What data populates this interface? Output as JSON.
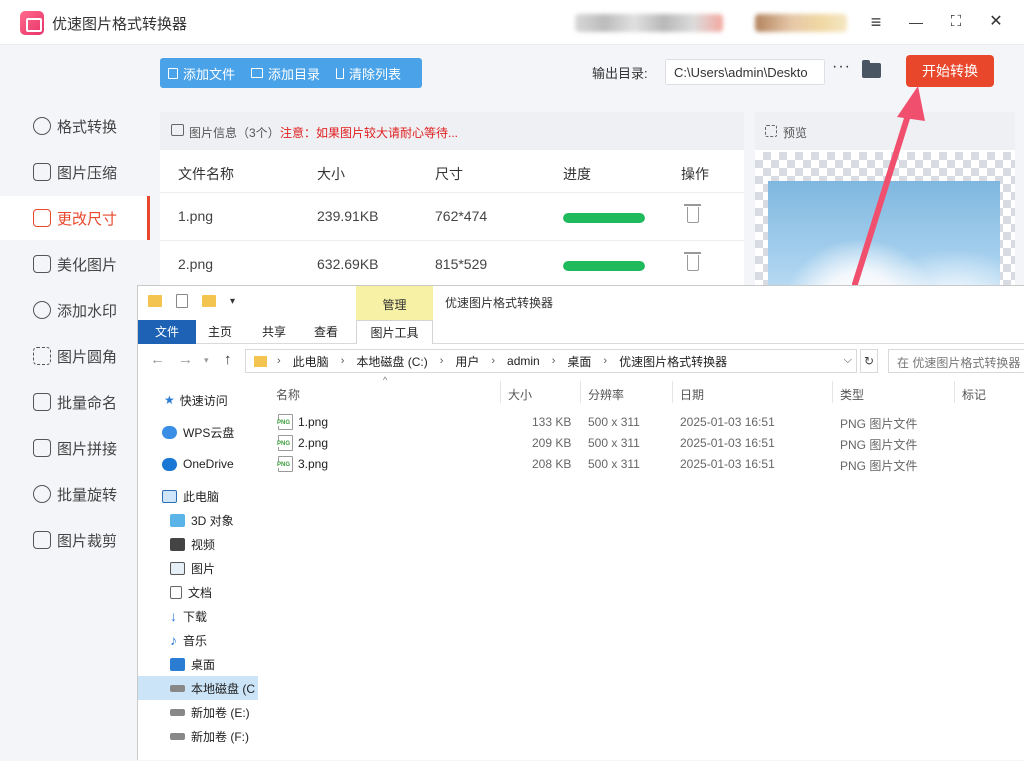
{
  "app": {
    "title": "优速图片格式转换器"
  },
  "window_controls": {
    "menu": "≡",
    "minimize": "—",
    "maximize": "⛶",
    "close": "✕"
  },
  "sidebar": {
    "items": [
      {
        "label": "格式转换",
        "icon": "format-convert-icon",
        "active": false
      },
      {
        "label": "图片压缩",
        "icon": "compress-icon",
        "active": false
      },
      {
        "label": "更改尺寸",
        "icon": "resize-icon",
        "active": true
      },
      {
        "label": "美化图片",
        "icon": "beautify-icon",
        "active": false
      },
      {
        "label": "添加水印",
        "icon": "watermark-icon",
        "active": false
      },
      {
        "label": "图片圆角",
        "icon": "round-corner-icon",
        "active": false
      },
      {
        "label": "批量命名",
        "icon": "rename-icon",
        "active": false
      },
      {
        "label": "图片拼接",
        "icon": "stitch-icon",
        "active": false
      },
      {
        "label": "批量旋转",
        "icon": "rotate-icon",
        "active": false
      },
      {
        "label": "图片裁剪",
        "icon": "crop-icon",
        "active": false
      }
    ]
  },
  "toolbar": {
    "add_file": "添加文件",
    "add_dir": "添加目录",
    "clear_list": "清除列表",
    "output_label": "输出目录:",
    "output_path": "C:\\Users\\admin\\Deskto",
    "more": "···",
    "start": "开始转换"
  },
  "list": {
    "info": "图片信息（3个）",
    "note": "注意：如果图片较大请耐心等待...",
    "headers": {
      "name": "文件名称",
      "size": "大小",
      "dims": "尺寸",
      "progress": "进度",
      "action": "操作"
    },
    "rows": [
      {
        "name": "1.png",
        "size": "239.91KB",
        "dims": "762*474",
        "progress": 1.0
      },
      {
        "name": "2.png",
        "size": "632.69KB",
        "dims": "815*529",
        "progress": 1.0
      }
    ]
  },
  "preview": {
    "label": "预览"
  },
  "explorer": {
    "manage_tab": "管理",
    "title": "优速图片格式转换器",
    "ribbon": [
      "文件",
      "主页",
      "共享",
      "查看",
      "图片工具"
    ],
    "breadcrumb": [
      "此电脑",
      "本地磁盘 (C:)",
      "用户",
      "admin",
      "桌面",
      "优速图片格式转换器"
    ],
    "search_placeholder": "在 优速图片格式转换器",
    "nav": [
      {
        "label": "快速访问",
        "icon": "star-icon"
      },
      {
        "label": "WPS云盘",
        "icon": "cloud-icon"
      },
      {
        "label": "OneDrive",
        "icon": "onedrive-icon"
      },
      {
        "label": "此电脑",
        "icon": "pc-icon"
      },
      {
        "label": "3D 对象",
        "icon": "cube-icon"
      },
      {
        "label": "视频",
        "icon": "video-icon"
      },
      {
        "label": "图片",
        "icon": "picture-icon"
      },
      {
        "label": "文档",
        "icon": "document-icon"
      },
      {
        "label": "下载",
        "icon": "download-icon"
      },
      {
        "label": "音乐",
        "icon": "music-icon"
      },
      {
        "label": "桌面",
        "icon": "desktop-icon"
      },
      {
        "label": "本地磁盘 (C",
        "icon": "drive-icon"
      },
      {
        "label": "新加卷 (E:)",
        "icon": "drive-icon"
      },
      {
        "label": "新加卷 (F:)",
        "icon": "drive-icon"
      }
    ],
    "columns": {
      "name": "名称",
      "size": "大小",
      "resolution": "分辨率",
      "date": "日期",
      "type": "类型",
      "tags": "标记"
    },
    "files": [
      {
        "name": "1.png",
        "size": "133 KB",
        "resolution": "500 x 311",
        "date": "2025-01-03 16:51",
        "type": "PNG 图片文件"
      },
      {
        "name": "2.png",
        "size": "209 KB",
        "resolution": "500 x 311",
        "date": "2025-01-03 16:51",
        "type": "PNG 图片文件"
      },
      {
        "name": "3.png",
        "size": "208 KB",
        "resolution": "500 x 311",
        "date": "2025-01-03 16:51",
        "type": "PNG 图片文件"
      }
    ]
  },
  "colors": {
    "accent": "#e8472c",
    "toolbar_blue": "#4aa3e8",
    "progress_green": "#1fba5c",
    "arrow_pink": "#f0506e"
  }
}
